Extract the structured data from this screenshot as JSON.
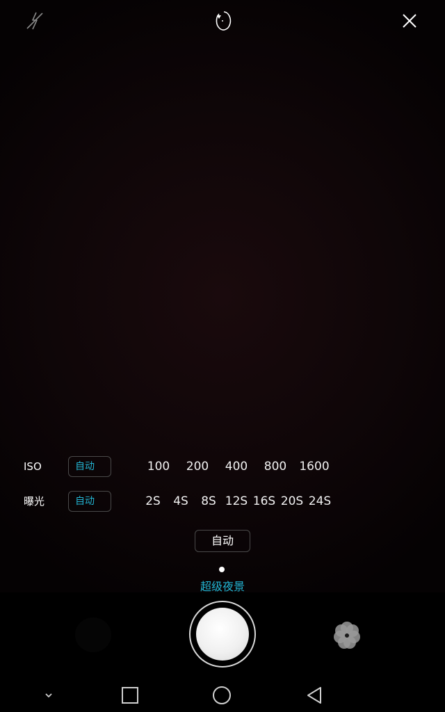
{
  "iso": {
    "label": "ISO",
    "auto": "自动",
    "options": [
      "100",
      "200",
      "400",
      "800",
      "1600"
    ]
  },
  "exposure": {
    "label": "曝光",
    "auto": "自动",
    "options": [
      "2S",
      "4S",
      "8S",
      "12S",
      "16S",
      "20S",
      "24S"
    ]
  },
  "auto_button": "自动",
  "mode": "超级夜景",
  "colors": {
    "accent": "#23b5d3",
    "background": "#000000",
    "viewfinder": "#12080a"
  },
  "icons": {
    "top": [
      "flash-off-icon",
      "camera-switch-icon",
      "close-icon"
    ],
    "bottom": [
      "gallery-thumbnail",
      "shutter-button",
      "filter-flower-icon"
    ],
    "nav": [
      "chevron-down-icon",
      "recent-apps-icon",
      "home-icon",
      "back-icon"
    ]
  }
}
